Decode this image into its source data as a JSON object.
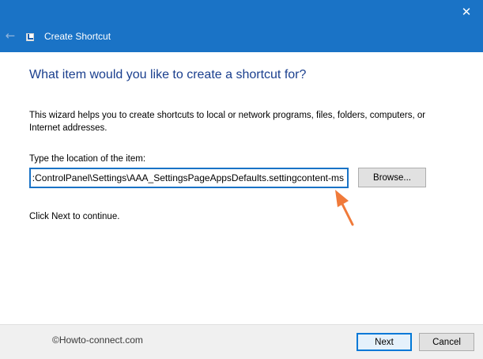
{
  "window": {
    "title": "Create Shortcut",
    "close_glyph": "✕",
    "back_glyph": "←",
    "icon": "shortcut-icon"
  },
  "main": {
    "heading": "What item would you like to create a shortcut for?",
    "description": "This wizard helps you to create shortcuts to local or network programs, files, folders, computers, or Internet addresses.",
    "field_label": "Type the location of the item:",
    "location_value": ":ControlPanel\\Settings\\AAA_SettingsPageAppsDefaults.settingcontent-ms",
    "browse_label": "Browse...",
    "continue_text": "Click Next to continue."
  },
  "footer": {
    "watermark": "©Howto-connect.com",
    "next_label": "Next",
    "cancel_label": "Cancel"
  },
  "colors": {
    "titlebar": "#1a73c6",
    "heading": "#1a3f8e",
    "annotation_arrow": "#f07a3a"
  }
}
